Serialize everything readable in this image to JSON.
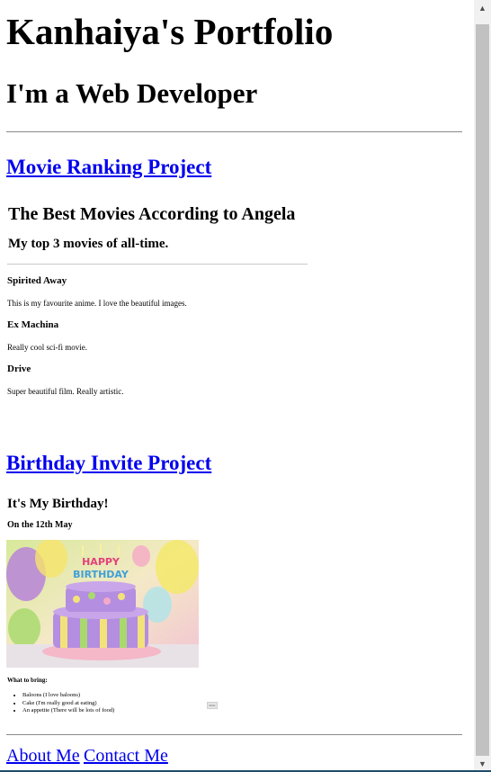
{
  "header": {
    "title": "Kanhaiya's Portfolio",
    "subtitle": "I'm a Web Developer"
  },
  "projects": {
    "movie_link": "Movie Ranking Project",
    "movie_embed": {
      "heading": "The Best Movies According to Angela",
      "subheading": "My top 3 movies of all-time.",
      "movies": [
        {
          "name": "Spirited Away",
          "desc": "This is my favourite anime. I love the beautiful images."
        },
        {
          "name": "Ex Machina",
          "desc": "Really cool sci-fi movie."
        },
        {
          "name": "Drive",
          "desc": "Super beautiful film. Really artistic."
        }
      ]
    },
    "birthday_link": "Birthday Invite Project",
    "birthday_embed": {
      "heading": "It's My Birthday!",
      "date": "On the 12th May",
      "cake_text": "HAPPY BIRTHDAY",
      "bring_heading": "What to bring:",
      "items": [
        "Baloons (I love baloons)",
        "Cake (I'm really good at eating)",
        "An appetite (There will be lots of food)"
      ],
      "tiny_button": "Invite"
    }
  },
  "footer": {
    "about": "About Me",
    "contact": "Contact Me"
  },
  "colors": {
    "link": "#0000ee",
    "scroll_thumb": "#c1c1c1"
  }
}
